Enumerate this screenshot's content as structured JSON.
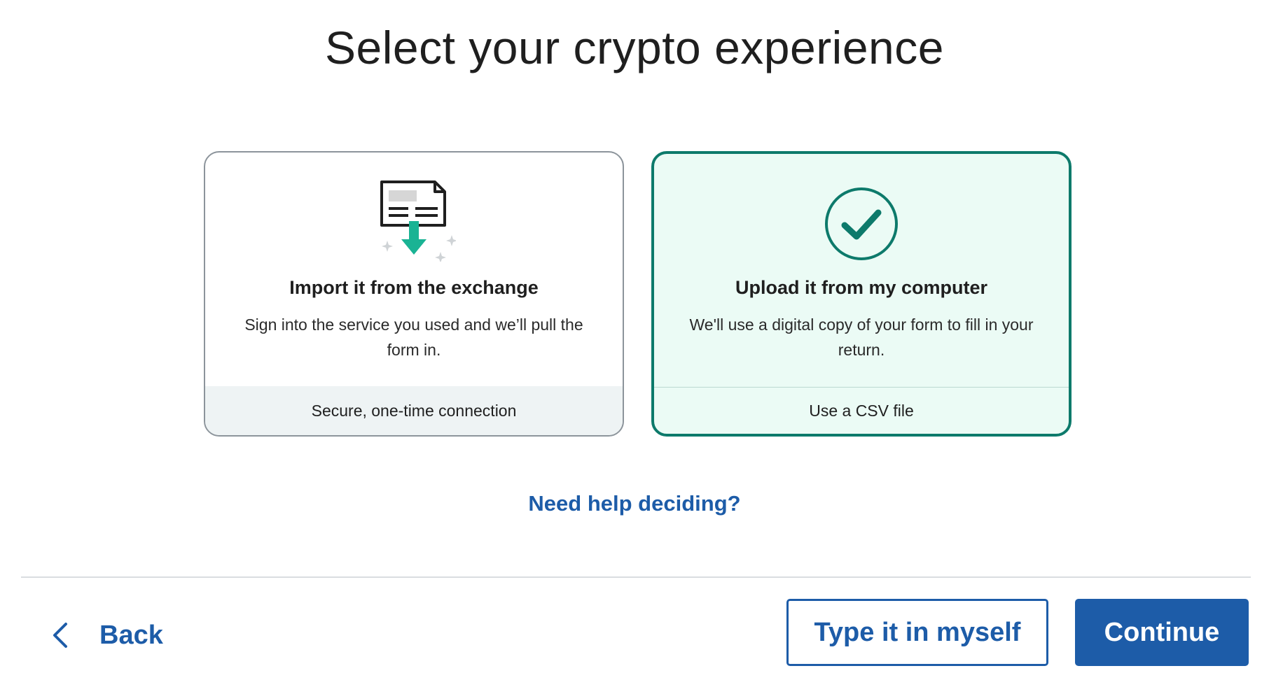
{
  "page": {
    "title": "Select your crypto experience"
  },
  "options": [
    {
      "title": "Import it from the exchange",
      "description": "Sign into the service you used and we’ll pull the form in.",
      "footer": "Secure, one-time connection",
      "icon": "document-download-icon",
      "selected": false
    },
    {
      "title": "Upload it from my computer",
      "description": "We'll use a digital copy of your form to fill in your return.",
      "footer": "Use a CSV file",
      "icon": "checkmark-circle-icon",
      "selected": true
    }
  ],
  "help": {
    "label": "Need help deciding?"
  },
  "footer_nav": {
    "back_label": "Back",
    "back_icon": "chevron-left-icon",
    "type_label": "Type it in myself",
    "continue_label": "Continue"
  },
  "colors": {
    "brand_blue": "#1d5ca8",
    "selected_border": "#0d7a6b",
    "selected_bg": "#ebfbf5",
    "accent_green": "#1ab394"
  }
}
